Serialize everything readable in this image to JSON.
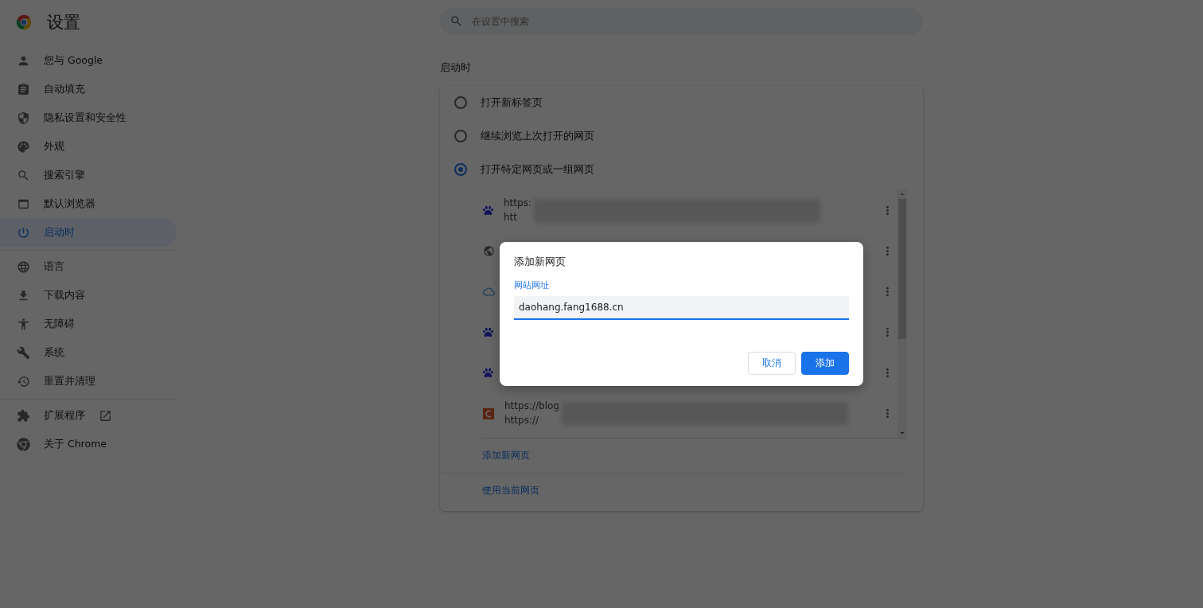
{
  "header": {
    "title": "设置"
  },
  "search": {
    "placeholder": "在设置中搜索"
  },
  "sidebar": {
    "groups": [
      [
        {
          "label": "您与 Google",
          "selected": false
        },
        {
          "label": "自动填充",
          "selected": false
        },
        {
          "label": "隐私设置和安全性",
          "selected": false
        },
        {
          "label": "外观",
          "selected": false
        },
        {
          "label": "搜索引擎",
          "selected": false
        },
        {
          "label": "默认浏览器",
          "selected": false
        },
        {
          "label": "启动时",
          "selected": true
        }
      ],
      [
        {
          "label": "语言",
          "selected": false
        },
        {
          "label": "下载内容",
          "selected": false
        },
        {
          "label": "无障碍",
          "selected": false
        },
        {
          "label": "系统",
          "selected": false
        },
        {
          "label": "重置并清理",
          "selected": false
        }
      ],
      [
        {
          "label": "扩展程序",
          "selected": false
        },
        {
          "label": "关于 Chrome",
          "selected": false
        }
      ]
    ]
  },
  "section": {
    "title": "启动时",
    "options": [
      {
        "label": "打开新标签页",
        "selected": false
      },
      {
        "label": "继续浏览上次打开的网页",
        "selected": false
      },
      {
        "label": "打开特定网页或一组网页",
        "selected": true
      }
    ],
    "pages": [
      {
        "kind": "paw",
        "lines": [
          "https:",
          "htt"
        ]
      },
      {
        "kind": "globe"
      },
      {
        "kind": "cloud"
      },
      {
        "kind": "paw"
      },
      {
        "kind": "paw"
      },
      {
        "kind": "letter",
        "lines": [
          "https://blog",
          "https://"
        ]
      }
    ],
    "links": [
      "添加新网页",
      "使用当前网页"
    ]
  },
  "dialog": {
    "title": "添加新网页",
    "field": {
      "label": "网站网址",
      "value": "daohang.fang1688.cn"
    },
    "buttons": [
      {
        "label": "取消",
        "kind": "secondary"
      },
      {
        "label": "添加",
        "kind": "primary"
      }
    ]
  }
}
